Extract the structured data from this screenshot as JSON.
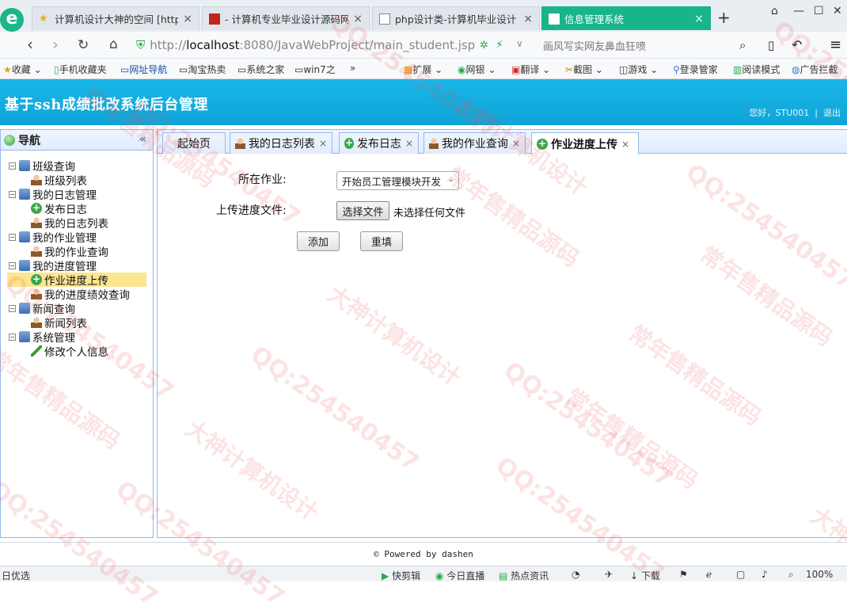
{
  "browser": {
    "tabs": [
      {
        "title": "计算机设计大神的空间 [http:",
        "active": false
      },
      {
        "title": "- 计算机专业毕业设计源码网",
        "active": false
      },
      {
        "title": "php设计类-计算机毕业设计",
        "active": false
      },
      {
        "title": "信息管理系统",
        "active": true
      }
    ],
    "url_prefix": "http://",
    "url_host": "localhost",
    "url_rest": ":8080/JavaWebProject/main_student.jsp",
    "search_placeholder": "画风写实网友鼻血狂喷",
    "bookmarks": [
      "收藏",
      "手机收藏夹",
      "网址导航",
      "淘宝热卖",
      "系统之家",
      "win7之",
      "扩展",
      "网银",
      "翻译",
      "截图",
      "游戏",
      "登录管家",
      "阅读模式",
      "广告拦截"
    ]
  },
  "app": {
    "title": "基于ssh成绩批改系统后台管理",
    "greeting": "您好，STU001",
    "separator": "|",
    "logout": "退出"
  },
  "sidebar": {
    "title": "导航",
    "collapse_icon": "«",
    "groups": [
      {
        "label": "班级查询",
        "children": [
          {
            "label": "班级列表",
            "icon": "user-icon"
          }
        ]
      },
      {
        "label": "我的日志管理",
        "children": [
          {
            "label": "发布日志",
            "icon": "add-icon"
          },
          {
            "label": "我的日志列表",
            "icon": "user-icon"
          }
        ]
      },
      {
        "label": "我的作业管理",
        "children": [
          {
            "label": "我的作业查询",
            "icon": "user-icon"
          }
        ]
      },
      {
        "label": "我的进度管理",
        "children": [
          {
            "label": "作业进度上传",
            "icon": "add-icon"
          },
          {
            "label": "我的进度绩效查询",
            "icon": "user-icon"
          }
        ]
      },
      {
        "label": "新闻查询",
        "children": [
          {
            "label": "新闻列表",
            "icon": "user-icon"
          }
        ]
      },
      {
        "label": "系统管理",
        "children": [
          {
            "label": "修改个人信息",
            "icon": "pen-icon"
          }
        ]
      }
    ],
    "toggle": "−"
  },
  "tabs": [
    {
      "label": "起始页",
      "closable": false
    },
    {
      "label": "我的日志列表",
      "closable": true
    },
    {
      "label": "发布日志",
      "closable": true
    },
    {
      "label": "我的作业查询",
      "closable": true
    },
    {
      "label": "作业进度上传",
      "closable": true
    }
  ],
  "tab_close": "×",
  "form": {
    "job_label": "所在作业:",
    "job_value": "开始员工管理模块开发",
    "file_label": "上传进度文件:",
    "file_button": "选择文件",
    "file_status": "未选择任何文件",
    "add_button": "添加",
    "reset_button": "重填"
  },
  "footer": "© Powered by dashen",
  "statusbar": {
    "left": "日优选",
    "items": [
      "快剪辑",
      "今日直播",
      "热点资讯",
      "下载"
    ],
    "zoom": "100%"
  },
  "watermark": {
    "texts": [
      "大神计算机设计",
      "QQ:254540457",
      "常年售精品源码"
    ]
  }
}
